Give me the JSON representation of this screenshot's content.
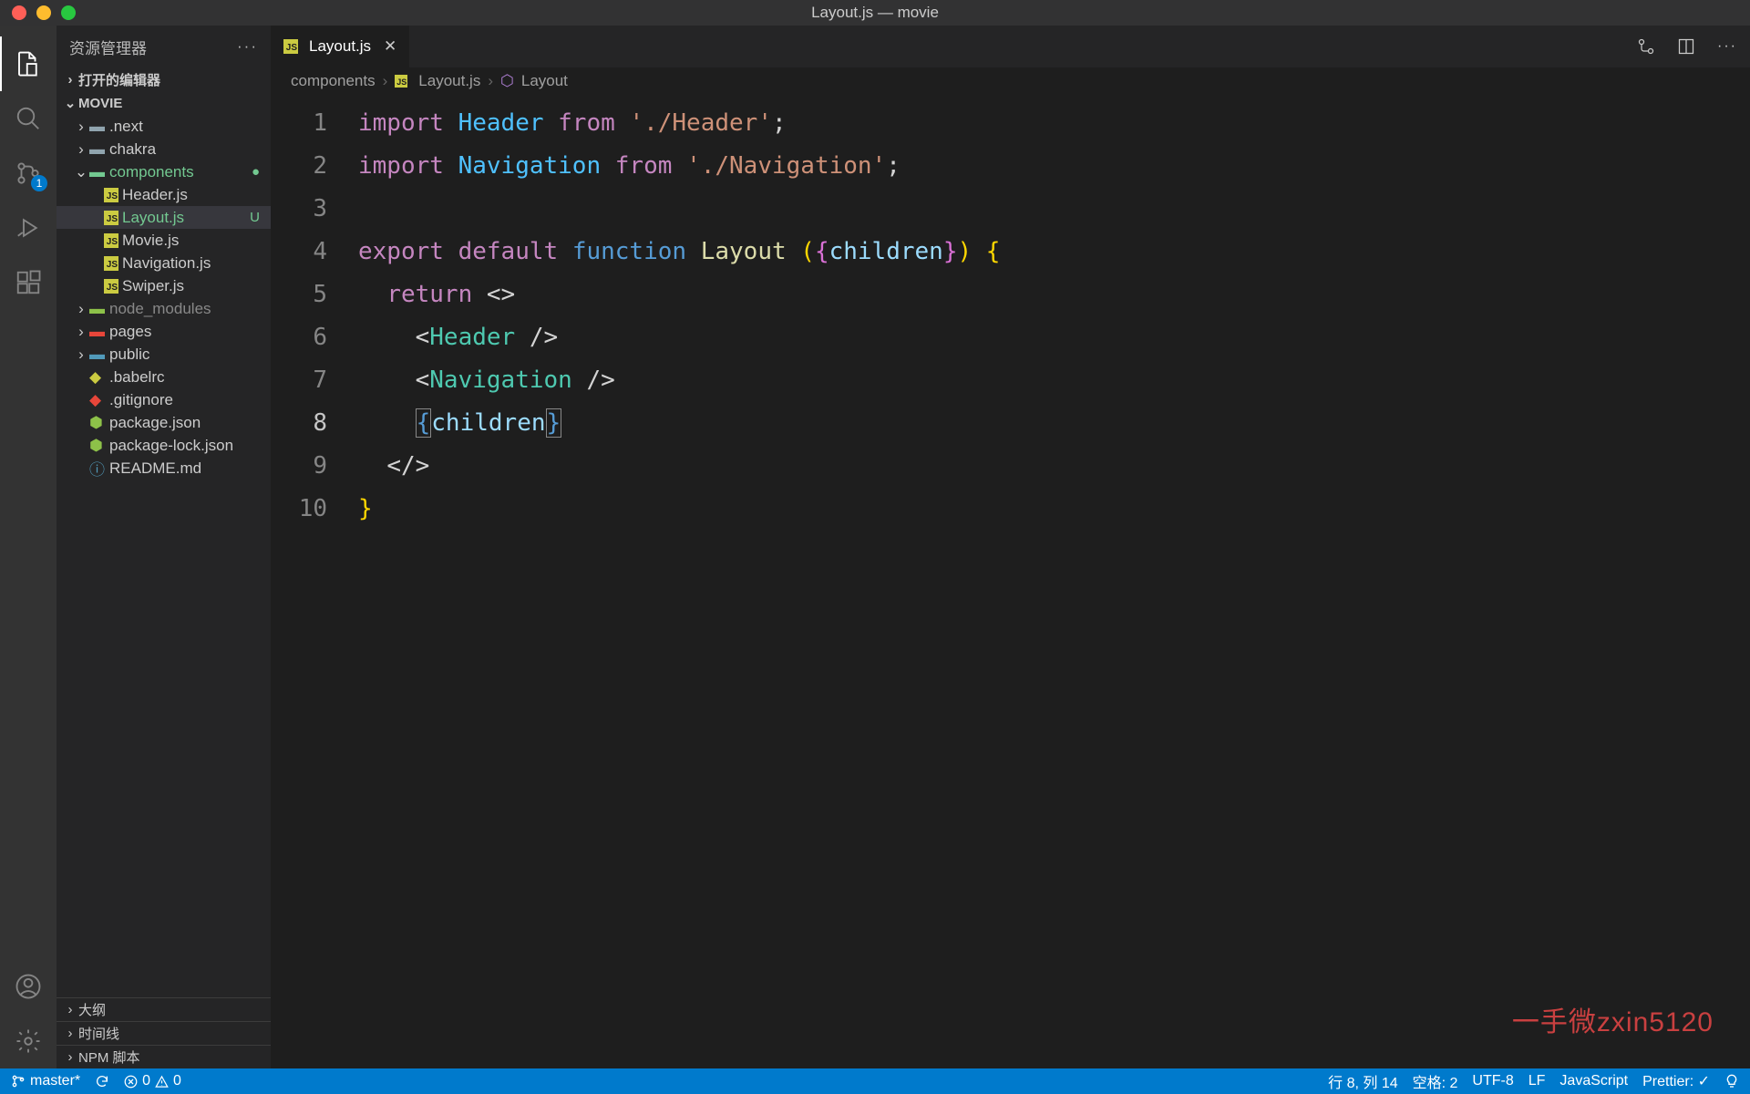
{
  "window": {
    "title": "Layout.js — movie"
  },
  "sidebar": {
    "title": "资源管理器",
    "sections": {
      "open_editors": "打开的编辑器",
      "outline": "大纲",
      "timeline": "时间线",
      "npm": "NPM 脚本"
    },
    "project": "MOVIE",
    "tree": {
      "next": ".next",
      "chakra": "chakra",
      "components": "components",
      "header": "Header.js",
      "layout": "Layout.js",
      "layout_status": "U",
      "movie": "Movie.js",
      "navigation": "Navigation.js",
      "swiper": "Swiper.js",
      "node_modules": "node_modules",
      "pages": "pages",
      "public": "public",
      "babelrc": ".babelrc",
      "gitignore": ".gitignore",
      "pkg": "package.json",
      "pkglock": "package-lock.json",
      "readme": "README.md"
    }
  },
  "tab": {
    "label": "Layout.js"
  },
  "breadcrumb": {
    "a": "components",
    "b": "Layout.js",
    "c": "Layout"
  },
  "code": {
    "l1_import": "import",
    "l1_Header": "Header",
    "l1_from": "from",
    "l1_path": "'./Header'",
    "l1_semi": ";",
    "l2_import": "import",
    "l2_Nav": "Navigation",
    "l2_from": "from",
    "l2_path": "'./Navigation'",
    "l2_semi": ";",
    "l4_export": "export",
    "l4_default": "default",
    "l4_function": "function",
    "l4_name": "Layout",
    "l4_children": "children",
    "l5_return": "return",
    "l6_Header": "Header",
    "l7_Nav": "Navigation",
    "l8_children": "children"
  },
  "scm_badge": "1",
  "statusbar": {
    "branch": "master*",
    "sync": "",
    "errors": "0",
    "warnings": "0",
    "line_col": "行 8, 列 14",
    "spaces": "空格: 2",
    "encoding": "UTF-8",
    "eol": "LF",
    "lang": "JavaScript",
    "prettier": "Prettier: ✓"
  },
  "watermark": "一手微zxin5120"
}
